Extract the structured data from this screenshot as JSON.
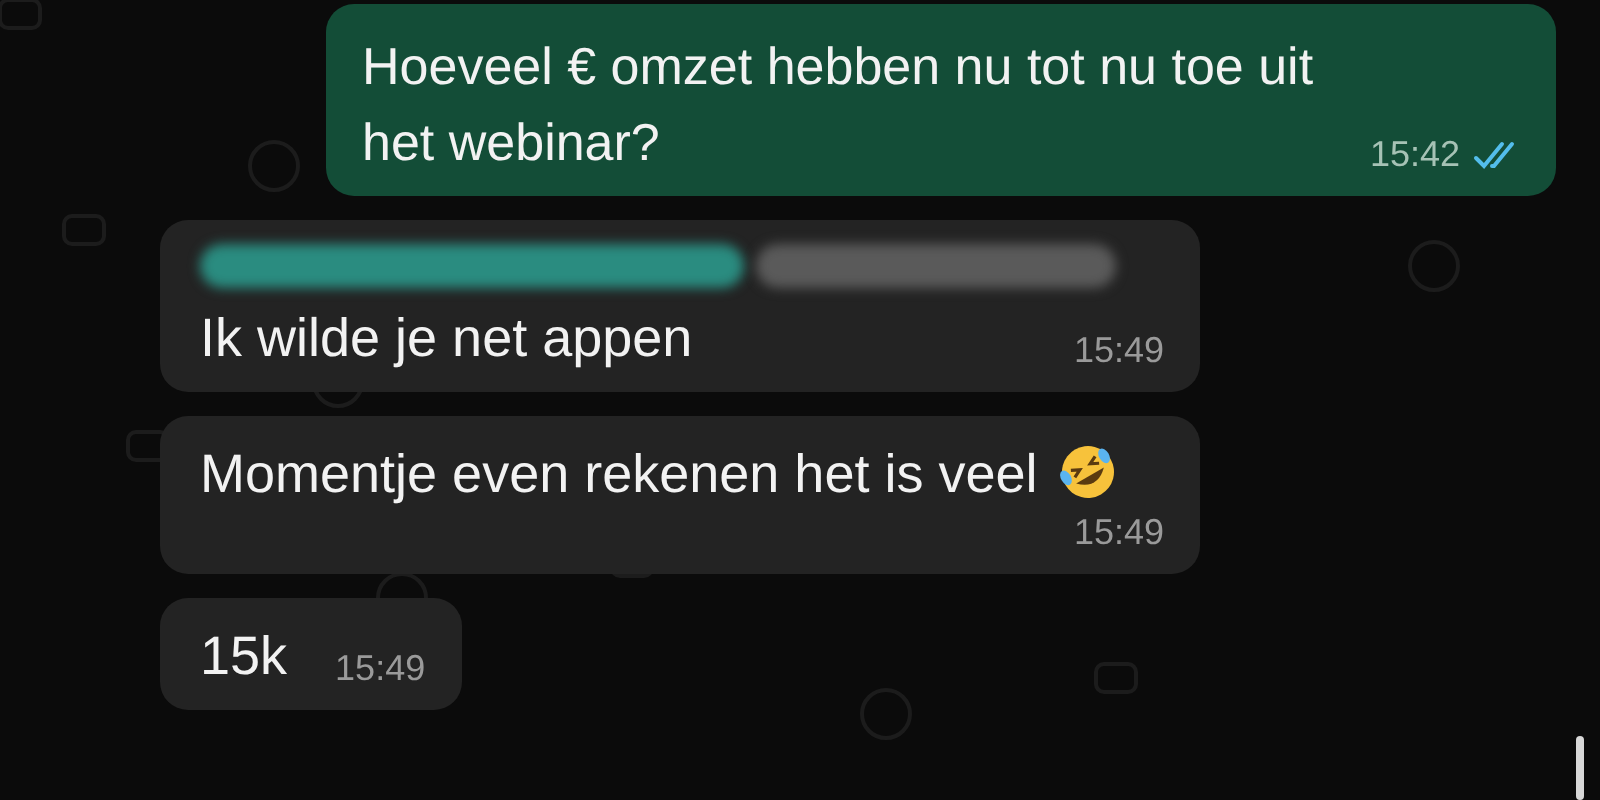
{
  "messages": [
    {
      "kind": "outgoing",
      "text": "Hoeveel € omzet hebben nu tot nu toe uit het webinar?",
      "time": "15:42",
      "read": true
    },
    {
      "kind": "incoming",
      "redacted_header": true,
      "text": "Ik wilde je net appen",
      "time": "15:49"
    },
    {
      "kind": "incoming",
      "text": "Momentje even rekenen het is veel",
      "emoji": true,
      "time": "15:49"
    },
    {
      "kind": "incoming",
      "text": "15k",
      "time": "15:49"
    }
  ]
}
